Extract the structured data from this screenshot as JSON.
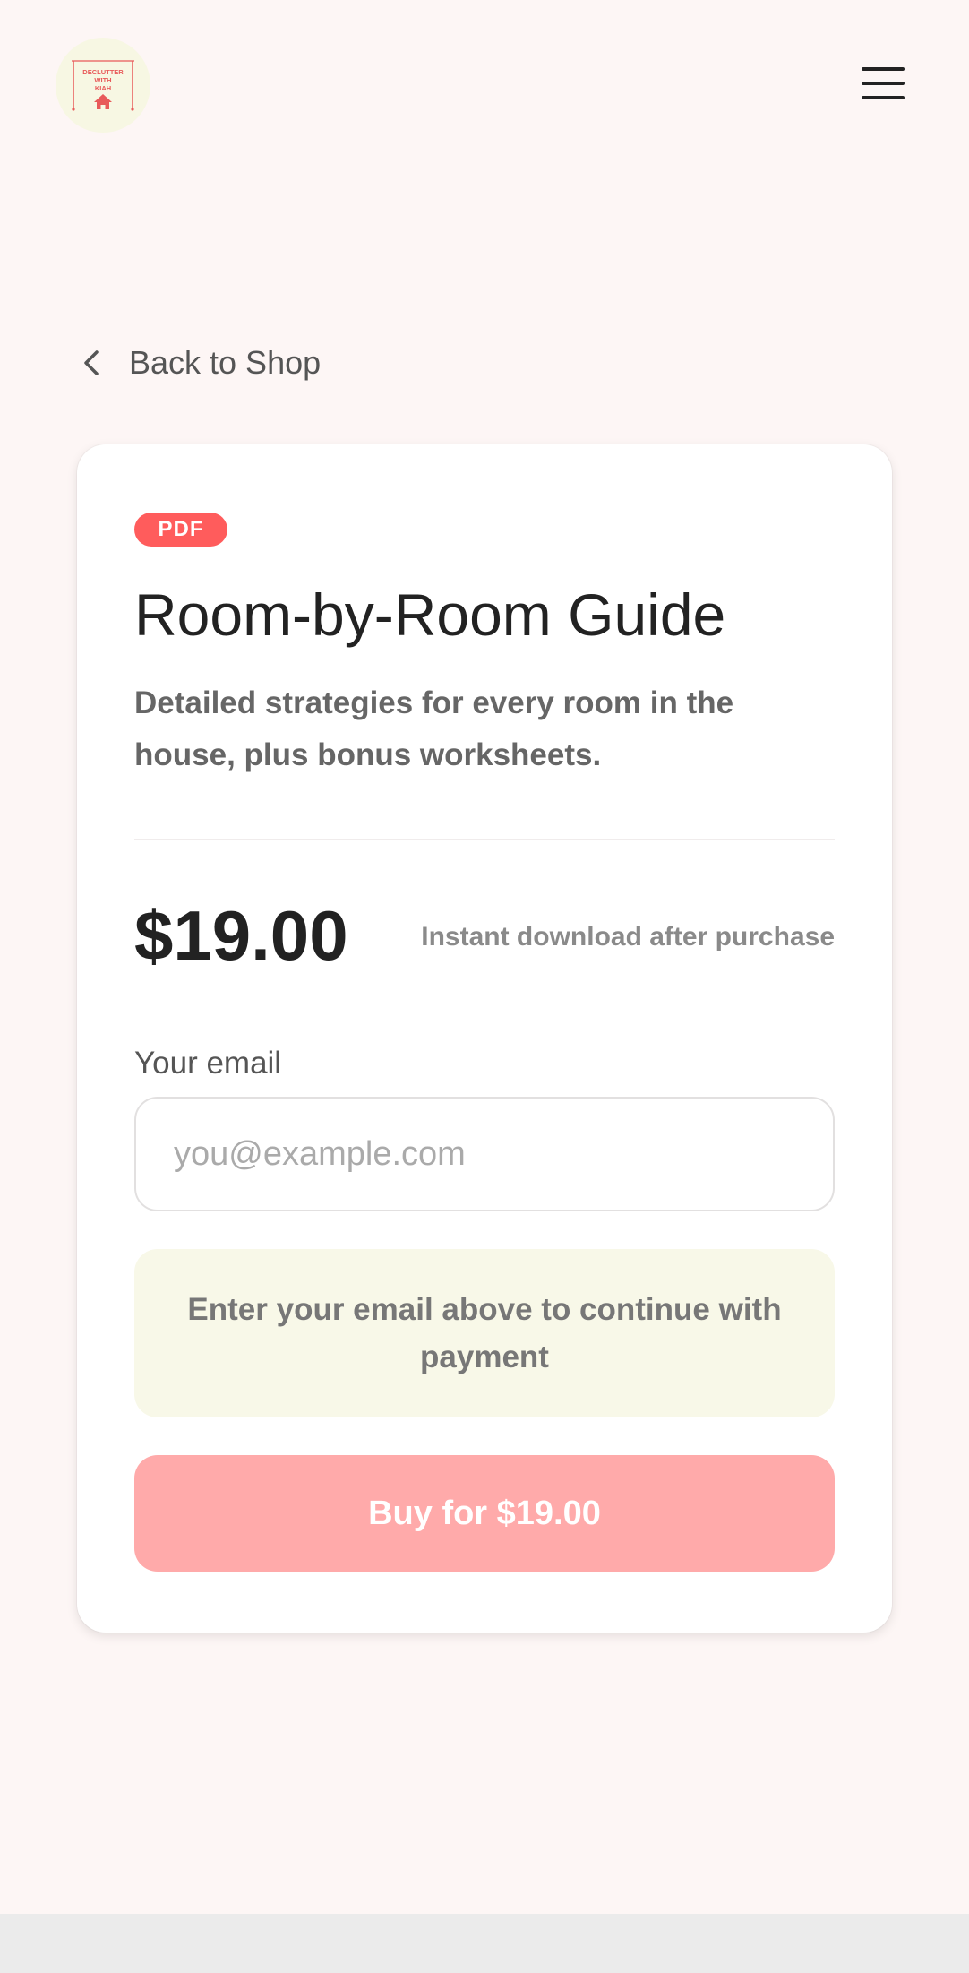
{
  "header": {
    "logo_text": [
      "DECLUTTER",
      "WITH",
      "KIAH"
    ],
    "menu_icon": "hamburger-menu-icon"
  },
  "nav": {
    "back_label": "Back to Shop",
    "back_icon": "chevron-left-icon"
  },
  "product": {
    "badge": "PDF",
    "title": "Room-by-Room Guide",
    "description": "Detailed strategies for every room in the house, plus bonus worksheets.",
    "price": "$19.00",
    "price_note": "Instant download after purchase"
  },
  "checkout": {
    "email_label": "Your email",
    "email_placeholder": "you@example.com",
    "email_value": "",
    "notice": "Enter your email above to continue with payment",
    "buy_label": "Buy for $19.00"
  },
  "colors": {
    "background": "#fdf6f5",
    "accent": "#ff5c5c",
    "button_disabled": "#ffaaaa",
    "notice_bg": "#f8f8e8",
    "logo_bg": "#f7f7e3"
  }
}
